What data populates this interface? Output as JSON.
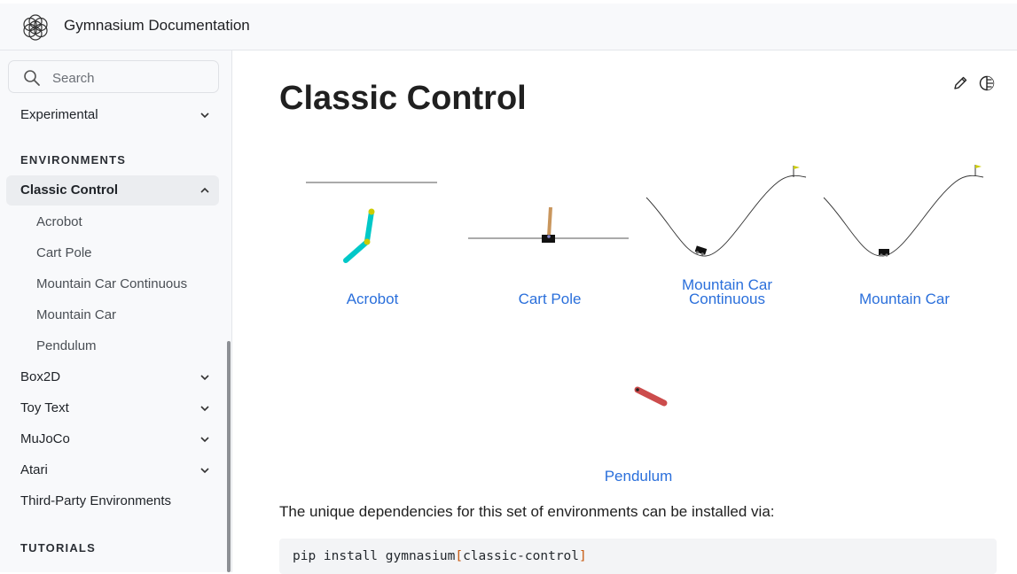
{
  "header": {
    "site_title": "Gymnasium Documentation",
    "logo_icon": "gymnasium-logo-icon"
  },
  "sidebar": {
    "search": {
      "placeholder": "Search"
    },
    "experimental": "Experimental",
    "environments_caption": "ENVIRONMENTS",
    "classic_control": "Classic Control",
    "classic_children": [
      "Acrobot",
      "Cart Pole",
      "Mountain Car Continuous",
      "Mountain Car",
      "Pendulum"
    ],
    "groups": [
      "Box2D",
      "Toy Text",
      "MuJoCo",
      "Atari"
    ],
    "third_party": "Third-Party Environments",
    "tutorials_caption": "TUTORIALS"
  },
  "main": {
    "title": "Classic Control",
    "actions": {
      "edit_icon": "pencil-icon",
      "theme_icon": "theme-toggle-icon"
    },
    "environments": [
      {
        "label_line1": "Acrobot",
        "label_line2": ""
      },
      {
        "label_line1": "Cart Pole",
        "label_line2": ""
      },
      {
        "label_line1": "Mountain Car",
        "label_line2": "Continuous"
      },
      {
        "label_line1": "Mountain Car",
        "label_line2": ""
      },
      {
        "label_line1": "Pendulum",
        "label_line2": ""
      }
    ],
    "deps_text": "The unique dependencies for this set of environments can be installed via:",
    "code": {
      "prefix": "pip install gymnasium",
      "open": "[",
      "extra": "classic-control",
      "close": "]"
    }
  },
  "colors": {
    "link": "#2a6fdb",
    "acrobot": "#00c8c8",
    "joint": "#cccc00",
    "pole": "#c9965d",
    "pendulum": "#cc4c4c",
    "bracket": "#c7590e"
  }
}
